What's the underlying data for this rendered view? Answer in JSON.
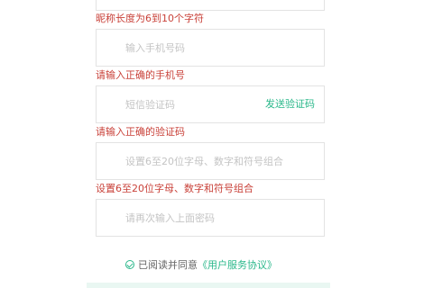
{
  "errors": {
    "nickname": "昵称长度为6到10个字符",
    "phone": "请输入正确的手机号",
    "code": "请输入正确的验证码",
    "password": "设置6至20位字母、数字和符号组合"
  },
  "fields": {
    "phone_placeholder": "输入手机号码",
    "code_placeholder": "短信验证码",
    "password_placeholder": "设置6至20位字母、数字和符号组合",
    "confirm_placeholder": "请再次输入上面密码"
  },
  "send_code_label": "发送验证码",
  "agreement": {
    "prefix": "已阅读并同意",
    "link": "《用户服务协议》"
  },
  "icons": {
    "agree": "check-circle-icon"
  },
  "colors": {
    "accent": "#2bb88b",
    "error": "#c9423a",
    "border": "#e3e3e3"
  }
}
